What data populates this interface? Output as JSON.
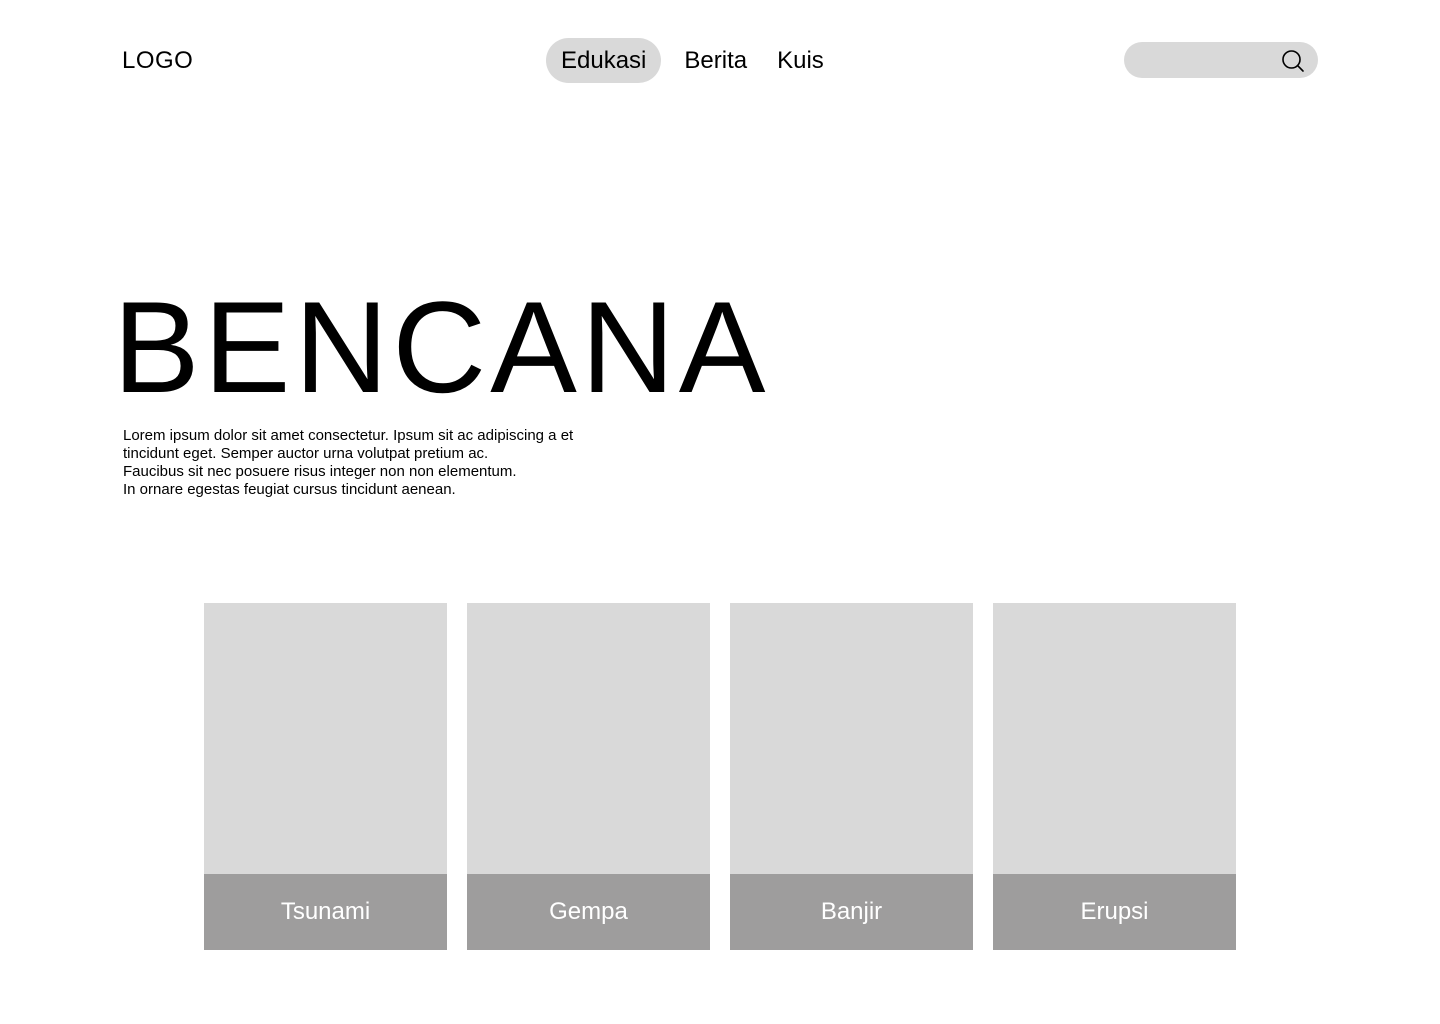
{
  "header": {
    "logo": "LOGO",
    "nav": [
      {
        "label": "Edukasi",
        "active": true
      },
      {
        "label": "Berita",
        "active": false
      },
      {
        "label": "Kuis",
        "active": false
      }
    ],
    "search": {
      "placeholder": "",
      "value": "",
      "icon": "search-icon"
    }
  },
  "hero": {
    "title": "BENCANA",
    "description_lines": [
      "Lorem ipsum dolor sit amet consectetur. Ipsum sit ac adipiscing a et",
      "tincidunt eget. Semper auctor urna volutpat pretium ac.",
      "Faucibus sit nec posuere risus integer non non elementum.",
      "In ornare egestas feugiat cursus tincidunt aenean."
    ]
  },
  "cards": [
    {
      "label": "Tsunami"
    },
    {
      "label": "Gempa"
    },
    {
      "label": "Banjir"
    },
    {
      "label": "Erupsi"
    }
  ],
  "colors": {
    "placeholder_gray": "#d9d9d9",
    "label_gray": "#9e9d9d",
    "text": "#000000",
    "label_text": "#ffffff"
  }
}
